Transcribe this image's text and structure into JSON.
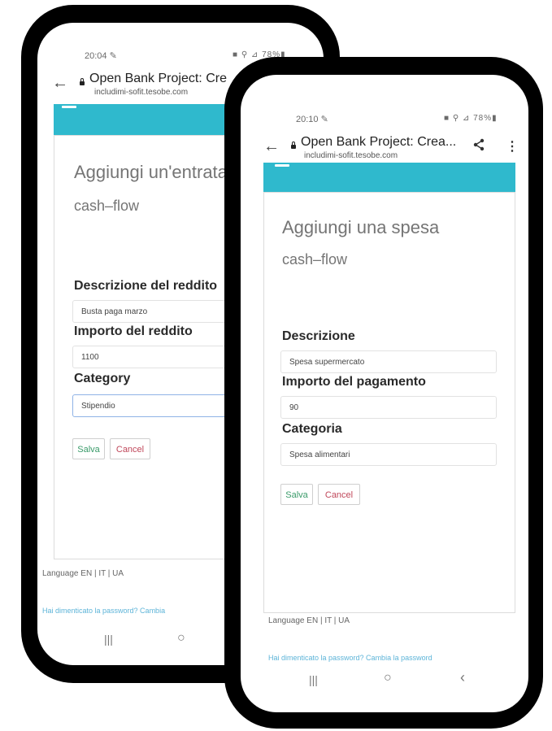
{
  "phone_back": {
    "status_time": "20:04 ✎",
    "status_icons": "■ ⚲ ⊿ 78%▮",
    "page_title": "Open Bank Project: Cre",
    "domain": "includimi-sofit.tesobe.com",
    "heading": "Aggiungi un'entrata",
    "subheading": "cash–flow",
    "labels": {
      "description": "Descrizione del reddito",
      "amount": "Importo del reddito",
      "category": "Category"
    },
    "values": {
      "description": "Busta paga marzo",
      "amount": "1100",
      "category": "Stipendio"
    },
    "buttons": {
      "save": "Salva",
      "cancel": "Cancel"
    },
    "language": "Language EN | IT | UA",
    "links": "Hai dimenticato la password?   Cambia"
  },
  "phone_front": {
    "status_time": "20:10 ✎",
    "status_icons": "■ ⚲ ⊿ 78%▮",
    "page_title": "Open Bank Project: Crea...",
    "domain": "includimi-sofit.tesobe.com",
    "heading": "Aggiungi una spesa",
    "subheading": "cash–flow",
    "labels": {
      "description": "Descrizione",
      "amount": "Importo del pagamento",
      "category": "Categoria"
    },
    "values": {
      "description": "Spesa supermercato",
      "amount": "90",
      "category": "Spesa alimentari"
    },
    "buttons": {
      "save": "Salva",
      "cancel": "Cancel"
    },
    "language": "Language EN | IT | UA",
    "links": "Hai dimenticato la password?   Cambia la password",
    "nav": {
      "recents": "|||",
      "home": "○",
      "back": "‹"
    }
  },
  "nav_back": {
    "recents": "|||",
    "home": "○"
  },
  "icons": {
    "back": "back-arrow-icon",
    "lock": "lock-icon",
    "share": "share-icon",
    "menu": "more-vert-icon",
    "hamburger": "hamburger-menu-icon"
  },
  "colors": {
    "accent": "#2fb9cd",
    "save": "#3a9b6a",
    "cancel": "#c0485b",
    "link": "#5db4d8"
  }
}
